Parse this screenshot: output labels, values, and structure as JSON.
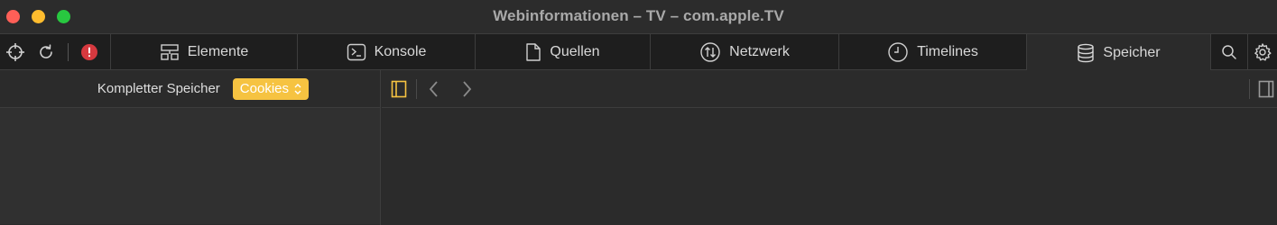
{
  "window": {
    "title": "Webinformationen – TV – com.apple.TV"
  },
  "toolbar": {
    "tools": [
      {
        "name": "crosshair-icon"
      },
      {
        "name": "reload-icon"
      },
      {
        "name": "error-badge-icon",
        "color": "#e5484d"
      }
    ],
    "tabs": [
      {
        "id": "elements",
        "label": "Elemente",
        "icon": "elements-icon"
      },
      {
        "id": "console",
        "label": "Konsole",
        "icon": "console-icon"
      },
      {
        "id": "sources",
        "label": "Quellen",
        "icon": "document-icon"
      },
      {
        "id": "network",
        "label": "Netzwerk",
        "icon": "network-icon"
      },
      {
        "id": "timelines",
        "label": "Timelines",
        "icon": "clock-icon"
      },
      {
        "id": "storage",
        "label": "Speicher",
        "icon": "database-icon",
        "active": true
      }
    ],
    "right_tools": [
      {
        "name": "search-icon"
      },
      {
        "name": "gear-icon"
      }
    ]
  },
  "sidebar": {
    "title": "Kompletter Speicher",
    "scope_select": {
      "value": "Cookies",
      "color": "#f6c341"
    }
  },
  "content": {
    "toolbar": {
      "toggle_color": "#f6c341"
    }
  }
}
